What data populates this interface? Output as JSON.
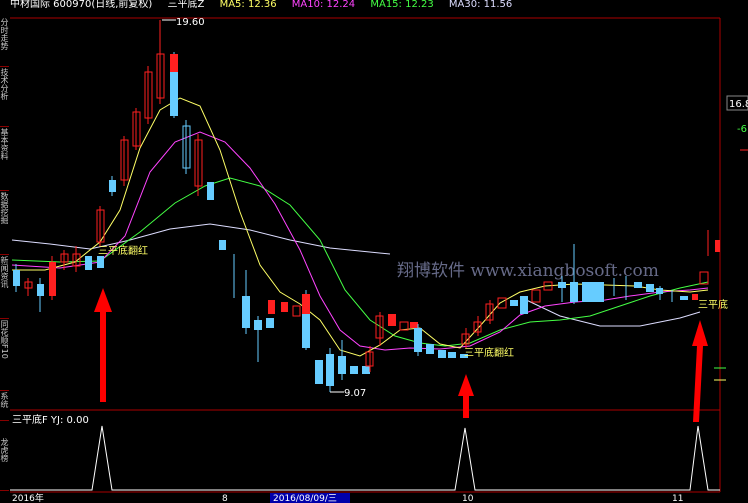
{
  "header": {
    "stock": "中材国际 600970(日线,前复权)",
    "indicator": "三平底Z",
    "ma5": "MA5: 12.36",
    "ma10": "MA10: 12.24",
    "ma15": "MA15: 12.23",
    "ma30": "MA30: 11.56"
  },
  "sidebar": {
    "tabs": [
      "分时走势",
      "技术分析",
      "基本资料",
      "数据挖掘",
      "新闻资讯",
      "同花顺F10",
      "系统"
    ]
  },
  "price_labels": {
    "high": "19.60",
    "low": "9.07"
  },
  "signals": {
    "label_1": "三平底翻红",
    "label_2": "三平底翻红",
    "label_3": "三平底"
  },
  "watermark": "翔博软件 www.xiangbosoft.com",
  "right_axis": {
    "value_1": "16.8",
    "value_2": "-6"
  },
  "sub_panel": {
    "title": "三平底F YJ: 0.00",
    "side_label": "龙虎榜"
  },
  "bottom_axis": {
    "year": "2016年",
    "tick_1": "8",
    "date_box": "2016/08/09/三",
    "tick_2": "10",
    "tick_3": "11"
  },
  "colors": {
    "up": "#ff2020",
    "down": "#66ccff",
    "ma5": "#ffff66",
    "ma10": "#ff44ff",
    "ma15": "#44ff44",
    "ma30": "#ddddff",
    "border": "#aa0000",
    "arrow": "#ff0000"
  },
  "chart_data": {
    "type": "candlestick",
    "price_labels": {
      "high": 19.6,
      "low": 9.07
    }
  }
}
